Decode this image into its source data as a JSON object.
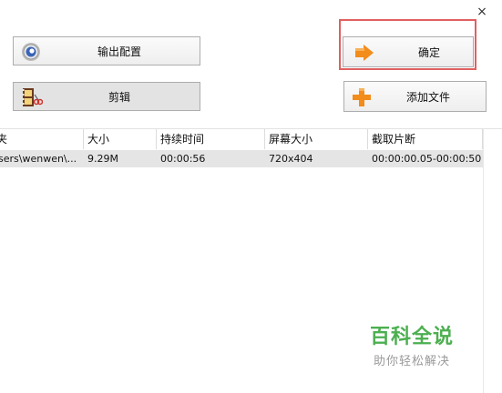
{
  "window": {
    "close_glyph": "×"
  },
  "buttons": {
    "config": {
      "label": "输出配置",
      "icon": "gear-disc-icon"
    },
    "edit": {
      "label": "剪辑",
      "icon": "film-scissors-icon"
    },
    "ok": {
      "label": "确定",
      "icon": "orange-arrow-icon"
    },
    "add_file": {
      "label": "添加文件",
      "icon": "orange-plus-icon"
    }
  },
  "table": {
    "columns": [
      "夹",
      "大小",
      "持续时间",
      "屏幕大小",
      "截取片断"
    ],
    "rows": [
      {
        "path": "sers\\wenwen\\...",
        "size": "9.29M",
        "duration": "00:00:56",
        "screen": "720x404",
        "clip": "00:00:00.05-00:00:50"
      }
    ]
  },
  "watermark": {
    "title": "百科全说",
    "subtitle": "助你轻松解决"
  },
  "colors": {
    "highlight_frame": "#e06060",
    "accent_orange": "#f28c1a",
    "watermark_green": "#4caf50"
  }
}
